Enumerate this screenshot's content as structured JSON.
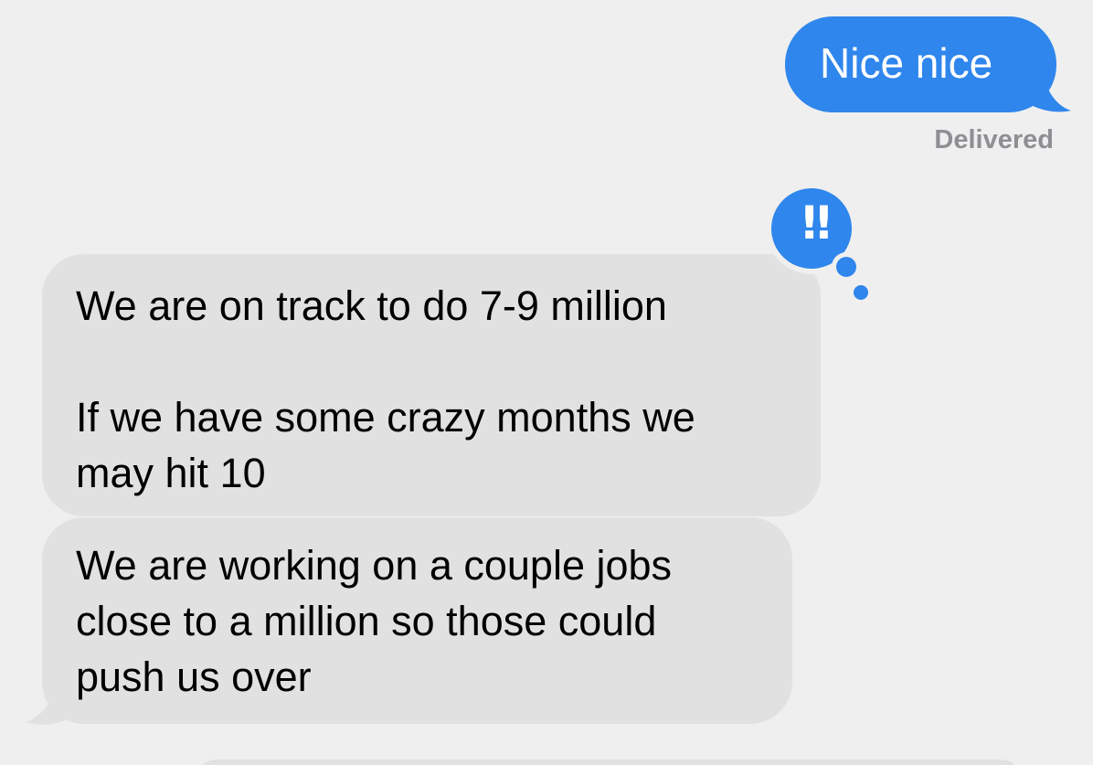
{
  "messages": {
    "sent": [
      {
        "text": "Nice nice",
        "status": "Delivered"
      }
    ],
    "received": [
      {
        "text": "We are on track to do 7-9 million\n\nIf we have some crazy months we\nmay hit 10"
      },
      {
        "text": "We are working on a couple jobs\nclose to a million so those could\npush us over"
      }
    ]
  },
  "tapback": {
    "icon": "exclamation-icon",
    "glyph": "!!",
    "color": "#2f86ec"
  },
  "colors": {
    "background": "#efefef",
    "sent_bubble": "#2f86ec",
    "received_bubble": "#e1e1e1",
    "status_text": "#8e8e93"
  }
}
